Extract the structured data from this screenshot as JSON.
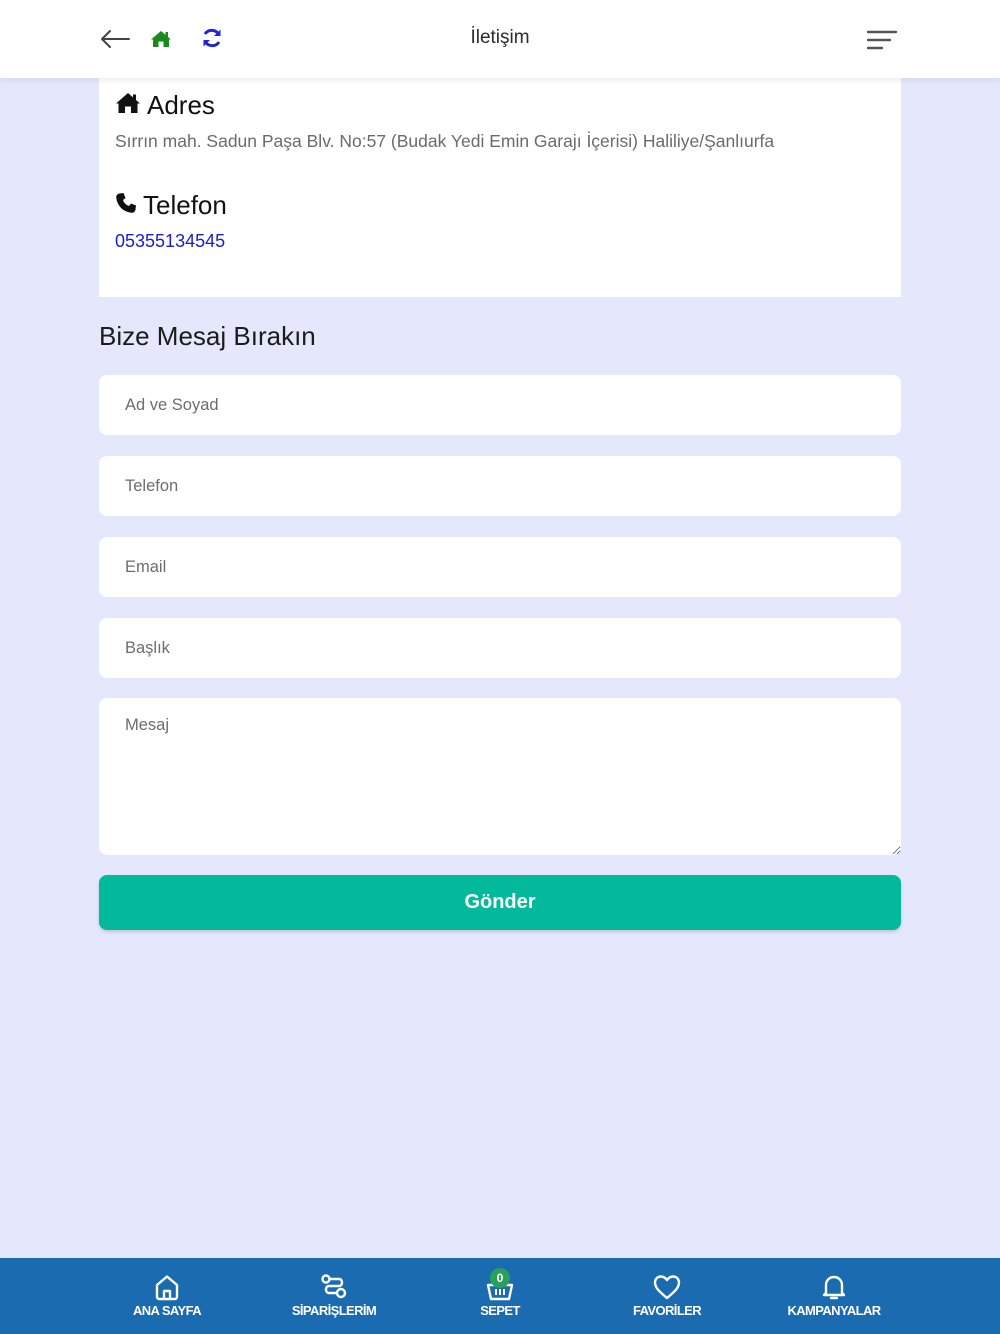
{
  "header": {
    "title": "İletişim",
    "icons": {
      "back": "arrow-left-icon",
      "home": "home-icon",
      "refresh": "refresh-icon",
      "menu": "hamburger-menu-icon"
    },
    "colors": {
      "home": "#1a8a1a",
      "refresh": "#2323d6"
    }
  },
  "contact": {
    "address_heading": "Adres",
    "address_text": "Sırrın mah. Sadun Paşa Blv. No:57 (Budak Yedi Emin Garajı İçerisi) Haliliye/Şanlıurfa",
    "phone_heading": "Telefon",
    "phone_number": "05355134545"
  },
  "form": {
    "title": "Bize Mesaj Bırakın",
    "name_placeholder": "Ad ve Soyad",
    "phone_placeholder": "Telefon",
    "email_placeholder": "Email",
    "subject_placeholder": "Başlık",
    "message_placeholder": "Mesaj",
    "submit_label": "Gönder",
    "submit_color": "#02b99b"
  },
  "bottom_nav": {
    "background": "#1a6bb0",
    "items": [
      {
        "label": "ANA SAYFA",
        "icon": "home-outline-icon"
      },
      {
        "label": "SİPARİŞLERİM",
        "icon": "route-icon"
      },
      {
        "label": "SEPET",
        "icon": "basket-icon",
        "badge": "0"
      },
      {
        "label": "FAVORİLER",
        "icon": "heart-icon"
      },
      {
        "label": "KAMPANYALAR",
        "icon": "bell-icon"
      }
    ]
  }
}
